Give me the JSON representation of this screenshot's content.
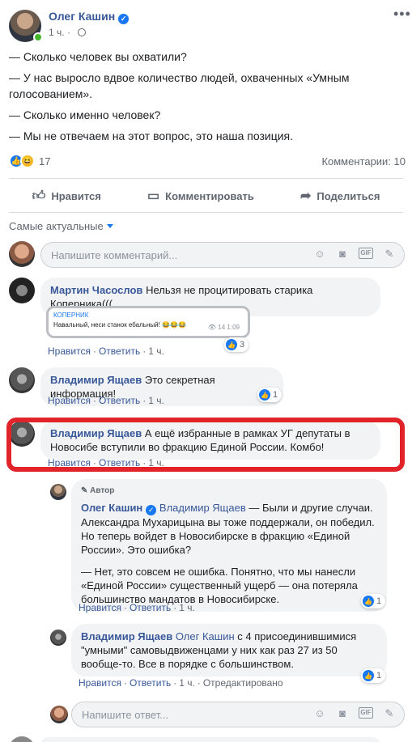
{
  "post": {
    "author": "Олег Кашин",
    "time": "1 ч.",
    "lines": [
      "— Сколько человек вы охватили?",
      "— У нас выросло вдвое количество людей, охваченных «Умным голосованием».",
      "— Сколько именно человек?",
      "— Мы не отвечаем на этот вопрос, это наша позиция."
    ],
    "reactions_count": "17",
    "comments_count": "Комментарии: 10"
  },
  "actions": {
    "like": "Нравится",
    "comment": "Комментировать",
    "share": "Поделиться"
  },
  "sort_label": "Самые актуальные",
  "comment_input_placeholder": "Напишите комментарий...",
  "reply_input_placeholder": "Напишите ответ...",
  "comment_links": {
    "like": "Нравится",
    "reply": "Ответить",
    "edited": "Отредактировано"
  },
  "comments": [
    {
      "name": "Мартин Часослов",
      "text": "Нельзя не процитировать старика Коперника(((",
      "attachment": {
        "title": "КОПЕРНИК",
        "text": "Навальный, неси станок ебальный! 😂😂😂",
        "meta": "👁 14  1:09"
      },
      "likes": "3",
      "time": "1 ч."
    },
    {
      "name": "Владимир Ящаев",
      "text": "Это секретная информация!",
      "likes": "1",
      "time": "1 ч."
    },
    {
      "name": "Владимир Ящаев",
      "text": "А ещё избранные в рамках УГ депутаты в Новосибе вступили во фракцию Единой России. Комбо!",
      "time": "1 ч."
    }
  ],
  "replies": [
    {
      "author_tag": "Автор",
      "name": "Олег Кашин",
      "mention": "Владимир Ящаев",
      "p1": "— Были и другие случаи. Александра Мухарицына вы тоже поддержали, он победил. Но теперь войдет в Новосибирске в фракцию «Единой России». Это ошибка?",
      "p2": "— Нет, это совсем не ошибка. Понятно, что мы нанесли «Единой России» существенный ущерб — она потеряла большинство мандатов в Новосибирске.",
      "likes": "1",
      "time": "1 ч."
    },
    {
      "name": "Владимир Ящаев",
      "mention": "Олег Кашин",
      "text": "с 4 присоединившимися \"умными\" самовыдвиженцами у них как раз 27 из 50 вообще-то. Все в порядке с большинством.",
      "likes": "1",
      "time": "1 ч."
    }
  ],
  "colors": {
    "link": "#385898",
    "accent": "#1877f2",
    "highlight": "#e0242a"
  }
}
